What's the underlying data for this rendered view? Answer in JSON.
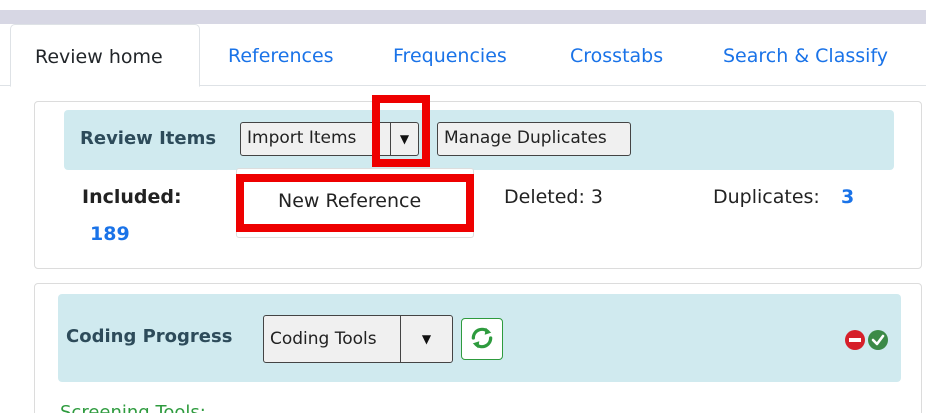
{
  "tabs": [
    {
      "label": "Review home",
      "active": true
    },
    {
      "label": "References",
      "active": false
    },
    {
      "label": "Frequencies",
      "active": false
    },
    {
      "label": "Crosstabs",
      "active": false
    },
    {
      "label": "Search & Classify",
      "active": false
    }
  ],
  "review_items": {
    "title": "Review Items",
    "import_label": "Import Items",
    "manage_duplicates_label": "Manage Duplicates",
    "dropdown_item": "New Reference",
    "included_label": "Included:",
    "included_value": "189",
    "deleted_text": "Deleted: 3",
    "duplicates_label": "Duplicates:",
    "duplicates_value": "3"
  },
  "coding_progress": {
    "title": "Coding Progress",
    "coding_tools_label": "Coding Tools",
    "screening_label": "Screening Tools:"
  },
  "colors": {
    "link": "#1a73e8",
    "panel_header": "#d0eaef",
    "highlight": "#ee0000",
    "success": "#2e9b3e"
  },
  "icons": {
    "refresh": "refresh-icon",
    "minus": "minus-circle-icon",
    "check": "check-circle-icon"
  }
}
